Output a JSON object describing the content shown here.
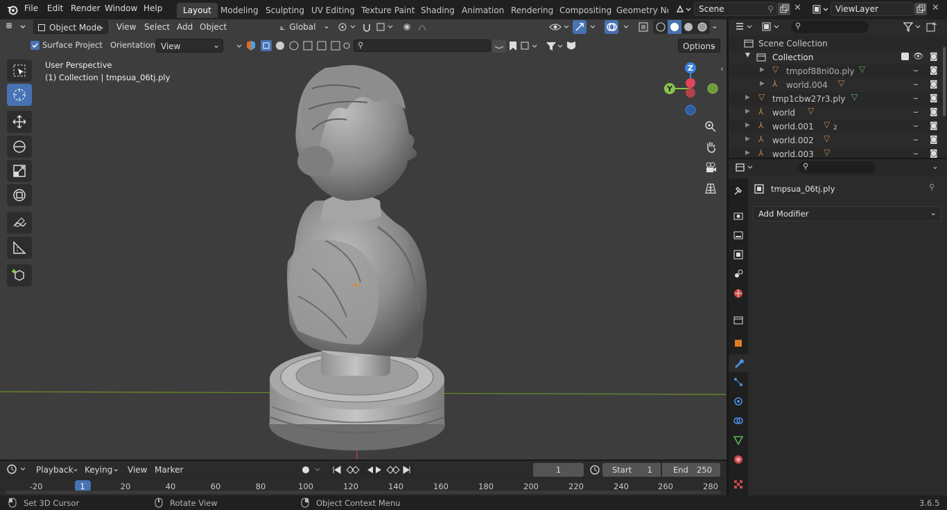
{
  "menu": {
    "items": [
      "File",
      "Edit",
      "Render",
      "Window",
      "Help"
    ]
  },
  "workspaces": {
    "tabs": [
      "Layout",
      "Modeling",
      "Sculpting",
      "UV Editing",
      "Texture Paint",
      "Shading",
      "Animation",
      "Rendering",
      "Compositing",
      "Geometry Noc"
    ],
    "active": "Layout"
  },
  "scene": {
    "name": "Scene"
  },
  "view_layer": {
    "name": "ViewLayer"
  },
  "viewport_header": {
    "mode": "Object Mode",
    "menus": [
      "View",
      "Select",
      "Add",
      "Object"
    ],
    "transform_orientation": "Global",
    "surface_project_label": "Surface Project",
    "surface_project_checked": true,
    "orientation_label": "Orientation:",
    "orientation_value": "View",
    "options_label": "Options"
  },
  "viewport": {
    "perspective_label": "User Perspective",
    "collection_label": "(1) Collection | tmpsua_06tj.ply",
    "gizmo": {
      "z": "Z",
      "y": "Y"
    },
    "colors": {
      "background": "#3d3d3d",
      "x_axis": "#e0485a",
      "y_axis": "#8bc34a",
      "z_axis": "#3a84e0",
      "grid_line": "#6b8f28"
    }
  },
  "outliner": {
    "root": "Scene Collection",
    "rows": [
      {
        "name": "Collection",
        "kind": "collection"
      },
      {
        "name": "tmpof88ni0o.ply",
        "kind": "mesh"
      },
      {
        "name": "world.004",
        "kind": "empty"
      },
      {
        "name": "tmp1cbw27r3.ply",
        "kind": "mesh"
      },
      {
        "name": "world",
        "kind": "empty"
      },
      {
        "name": "world.001",
        "kind": "empty",
        "badge": "2"
      },
      {
        "name": "world.002",
        "kind": "empty"
      },
      {
        "name": "world.003",
        "kind": "empty"
      }
    ]
  },
  "properties": {
    "object_name": "tmpsua_06tj.ply",
    "add_modifier_label": "Add Modifier"
  },
  "timeline": {
    "menus": [
      "Playback",
      "Keying",
      "View",
      "Marker"
    ],
    "current_frame": "1",
    "start_label": "Start",
    "start_value": "1",
    "end_label": "End",
    "end_value": "250",
    "ruler_ticks": [
      "-20",
      "1",
      "20",
      "40",
      "60",
      "80",
      "100",
      "120",
      "140",
      "160",
      "180",
      "200",
      "220",
      "240",
      "260",
      "280"
    ],
    "playhead": "1"
  },
  "status_bar": {
    "hints": [
      "Set 3D Cursor",
      "Rotate View",
      "Object Context Menu"
    ],
    "version": "3.6.5"
  }
}
